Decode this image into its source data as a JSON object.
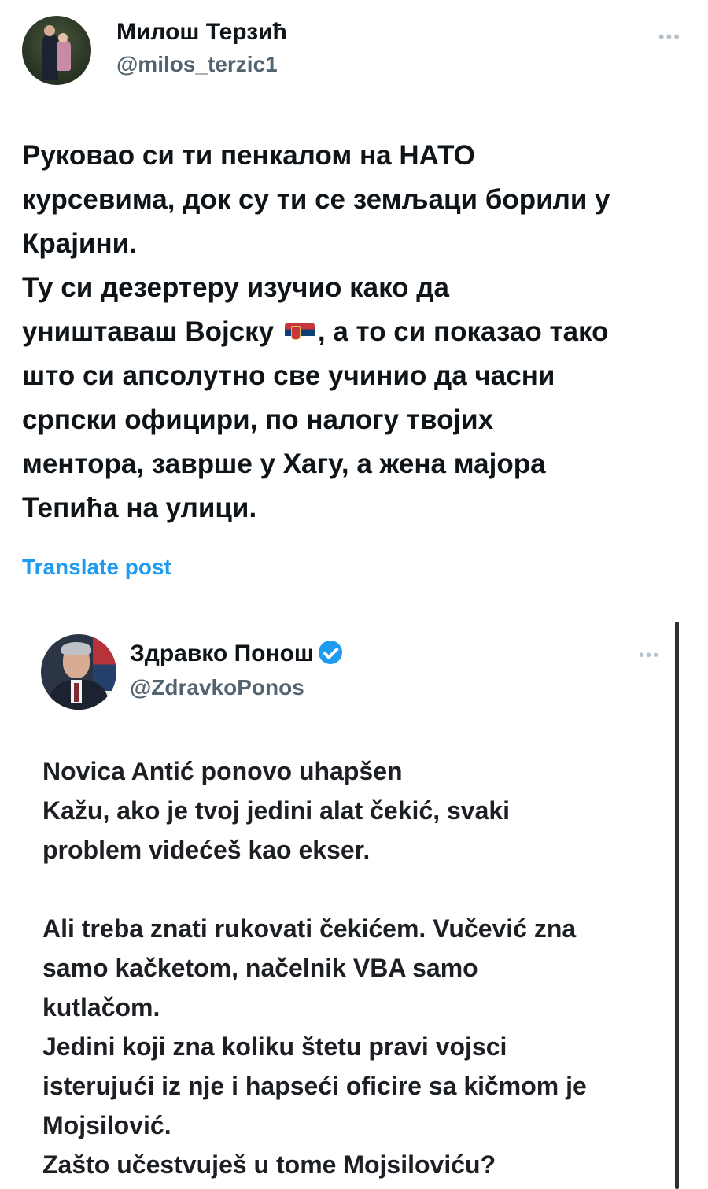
{
  "author": {
    "name": "Милош Терзић",
    "handle": "@milos_terzic1",
    "more_icon": "more-horizontal-icon"
  },
  "post": {
    "lines": [
      "Руковао си ти пенкалом на НАТО",
      "курсевима, док су ти се земљаци борили у",
      "Крајини.",
      "Ту си дезертеру изучио како да",
      "уништаваш Војску",
      ", а то си показао тако",
      "што си апсолутно све учинио да часни",
      "српски официри, по налогу твојих",
      "ментора, заврше у Хагу, а жена мајора",
      "Тепића на улици."
    ],
    "emoji": "serbia-flag-icon"
  },
  "translate_label": "Translate post",
  "quoted": {
    "name": "Здравко Понош",
    "verified": true,
    "handle": "@ZdravkoPonos",
    "more_icon": "more-horizontal-icon",
    "lines": [
      "Novica Antić ponovo uhapšen",
      "Kažu, ako je tvoj jedini alat čekić, svaki",
      "problem videćeš kao ekser.",
      "",
      "Ali treba znati rukovati čekićem. Vučević zna",
      "samo kačketom, načelnik VBA samo",
      "kutlačom.",
      "Jedini koji zna koliku štetu pravi vojsci",
      "isterujući iz nje i hapseći oficire sa kičmom je",
      "Mojsilović.",
      "Zašto učestvuješ u tome Mojsiloviću?"
    ]
  },
  "colors": {
    "link": "#1d9bf0",
    "text": "#0f1419",
    "secondary": "#536471"
  }
}
